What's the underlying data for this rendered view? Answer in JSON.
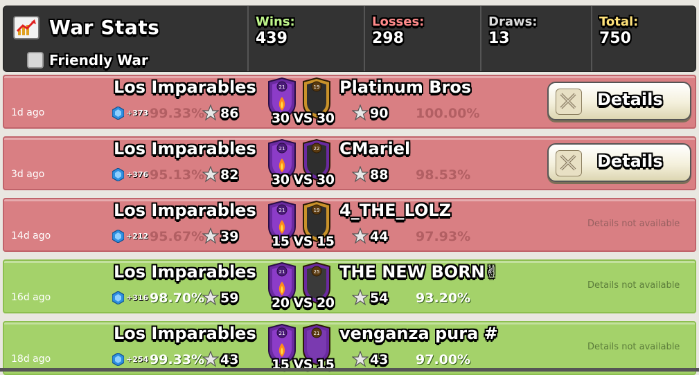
{
  "header": {
    "title": "War Stats",
    "friendly_label": "Friendly War",
    "friendly_checked": false,
    "stats": [
      {
        "label": "Wins:",
        "value": "439"
      },
      {
        "label": "Losses:",
        "value": "298"
      },
      {
        "label": "Draws:",
        "value": "13"
      },
      {
        "label": "Total:",
        "value": "750"
      }
    ]
  },
  "wars": [
    {
      "result": "loss",
      "ago": "1d ago",
      "clan_name": "Los Imparables",
      "clan_level": "21",
      "trophies": "+373",
      "clan_percent": "99.33%",
      "clan_stars": "86",
      "vs_text": "30 VS 30",
      "opponent_name": "Platinum Bros",
      "opponent_level": "19",
      "opponent_stars": "90",
      "opponent_percent": "100.00%",
      "details_label": "Details"
    },
    {
      "result": "loss",
      "ago": "3d ago",
      "clan_name": "Los Imparables",
      "clan_level": "21",
      "trophies": "+376",
      "clan_percent": "95.13%",
      "clan_stars": "82",
      "vs_text": "30 VS 30",
      "opponent_name": "CMariel",
      "opponent_level": "22",
      "opponent_stars": "88",
      "opponent_percent": "98.53%",
      "details_label": "Details"
    },
    {
      "result": "loss",
      "ago": "14d ago",
      "clan_name": "Los Imparables",
      "clan_level": "21",
      "trophies": "+212",
      "clan_percent": "95.67%",
      "clan_stars": "39",
      "vs_text": "15 VS 15",
      "opponent_name": "4_THE_LOLZ",
      "opponent_level": "19",
      "opponent_stars": "44",
      "opponent_percent": "97.93%",
      "na_label": "Details not available"
    },
    {
      "result": "win",
      "ago": "16d ago",
      "clan_name": "Los Imparables",
      "clan_level": "21",
      "trophies": "+316",
      "clan_percent": "98.70%",
      "clan_stars": "59",
      "vs_text": "20 VS 20",
      "opponent_name": "THE NEW BORN✌",
      "opponent_level": "25",
      "opponent_stars": "54",
      "opponent_percent": "93.20%",
      "na_label": "Details not available"
    },
    {
      "result": "win",
      "ago": "18d ago",
      "clan_name": "Los Imparables",
      "clan_level": "21",
      "trophies": "+254",
      "clan_percent": "99.33%",
      "clan_stars": "43",
      "vs_text": "15 VS 15",
      "opponent_name": "venganza pura #",
      "opponent_level": "21",
      "opponent_stars": "43",
      "opponent_percent": "97.00%",
      "na_label": "Details not available"
    }
  ],
  "colors": {
    "loss_row": "#d97f83",
    "win_row": "#a4d26a",
    "header_bg": "#333333"
  },
  "icons": {
    "stats": "stats-chart-icon",
    "trophy": "trophy-gem-icon",
    "star": "star-icon",
    "clan_badge": "clan-badge-icon",
    "swords": "crossed-swords-icon"
  }
}
